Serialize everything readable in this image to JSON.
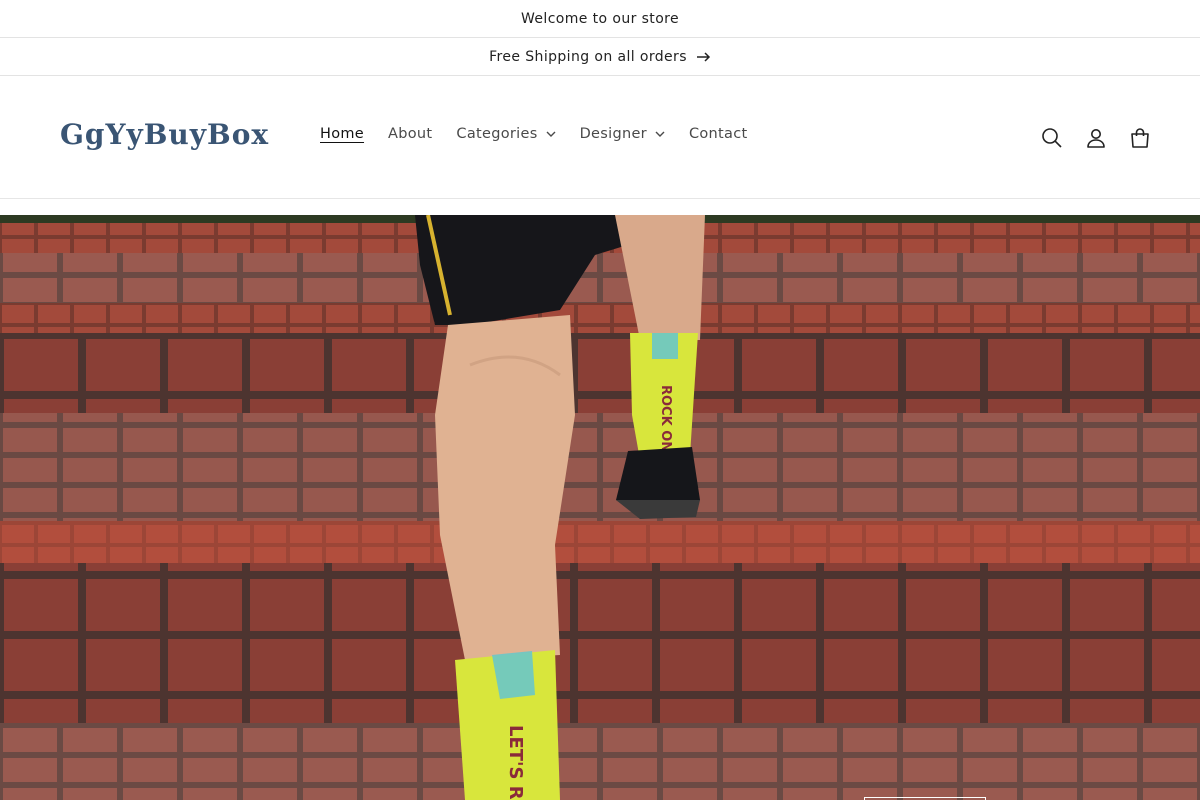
{
  "announcement_bar": {
    "welcome_text": "Welcome to our store",
    "shipping_text": "Free Shipping on all orders"
  },
  "header": {
    "logo_text": "GgYyBuyBox",
    "nav": [
      {
        "label": "Home",
        "active": true,
        "has_dropdown": false
      },
      {
        "label": "About",
        "active": false,
        "has_dropdown": false
      },
      {
        "label": "Categories",
        "active": false,
        "has_dropdown": true
      },
      {
        "label": "Designer",
        "active": false,
        "has_dropdown": true
      },
      {
        "label": "Contact",
        "active": false,
        "has_dropdown": false
      }
    ],
    "icons": [
      "search-icon",
      "account-icon",
      "cart-icon"
    ]
  },
  "hero": {
    "sock_text_top": "ROCK ON!",
    "sock_text_bottom": "LET'S RID",
    "colors": {
      "brick": "#b8523f",
      "sock": "#d8e63c",
      "sock_stripe": "#6ac6c8"
    }
  },
  "colors": {
    "logo": "#3a5574",
    "text": "#121212",
    "border": "#e3e3e3"
  }
}
